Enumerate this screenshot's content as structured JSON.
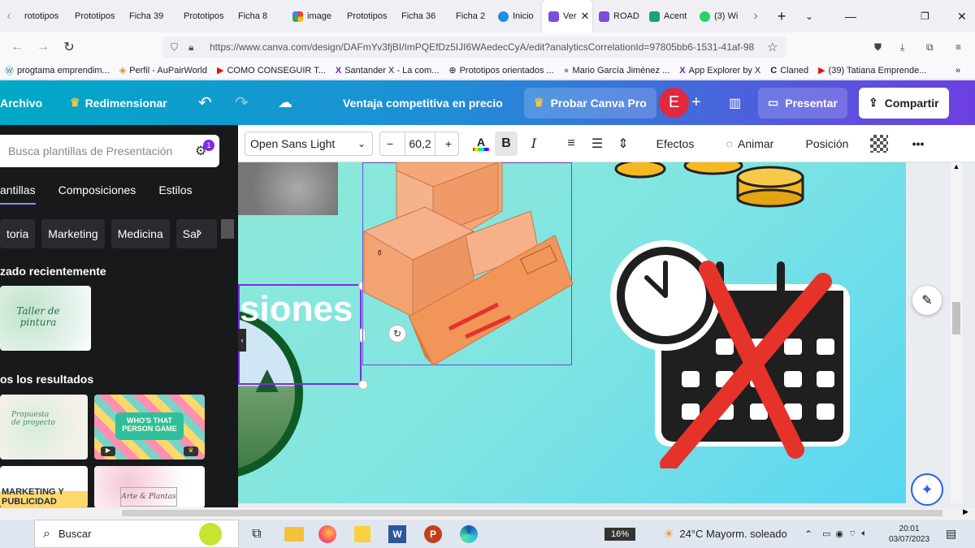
{
  "browser": {
    "tabs": [
      "rototipos",
      "Prototipos",
      "Ficha 39",
      "Prototipos",
      "Ficha 8",
      "image",
      "Prototipos",
      "Ficha 36",
      "Ficha 2",
      "Inicio",
      "Ver",
      "ROAD",
      "Acent",
      "(3) Wi"
    ],
    "active_tab_index": 10,
    "url": "https://www.canva.com/design/DAFmYv3fjBI/ImPQEfDz5IJI6WAedecCyA/edit?analyticsCorrelationId=97805bb6-1531-41af-98",
    "bookmarks": [
      "progtama emprendim...",
      "Perfil - AuPairWorld",
      "COMO CONSEGUIR T...",
      "Santander X - La com...",
      "Prototipos orientados ...",
      "Mario García Jiménez ...",
      "App Explorer by X",
      "Claned",
      "(39) Tatiana Emprende..."
    ]
  },
  "canva": {
    "archivo": "Archivo",
    "redimensionar": "Redimensionar",
    "design_title": "Ventaja competitiva en precio",
    "probar_pro": "Probar Canva Pro",
    "avatar_letter": "E",
    "presentar": "Presentar",
    "compartir": "Compartir"
  },
  "sidebar": {
    "search_placeholder": "Busca plantillas de Presentación",
    "filter_badge": "1",
    "tabs": [
      "antillas",
      "Composiciones",
      "Estilos"
    ],
    "chips": [
      "toria",
      "Marketing",
      "Medicina",
      "Sal"
    ],
    "recent_heading": "zado recientemente",
    "recent_thumb_text": "Taller de pintura",
    "results_heading": "os los resultados",
    "results": [
      "Propuesta de proyecto",
      "WHO'S THAT PERSON GAME",
      "MARKETING Y PUBLICIDAD",
      "Arte & Plantas"
    ]
  },
  "toolbar": {
    "font": "Open Sans Light",
    "font_size": "60,2",
    "bold": "B",
    "italic": "I",
    "efectos": "Efectos",
    "animar": "Animar",
    "posicion": "Posición",
    "more": "•••"
  },
  "slide": {
    "text_fragment": "siones"
  },
  "taskbar": {
    "search": "Buscar",
    "battery": "16%",
    "weather": "24°C  Mayorm. soleado",
    "time": "20:01",
    "date": "03/07/2023"
  }
}
